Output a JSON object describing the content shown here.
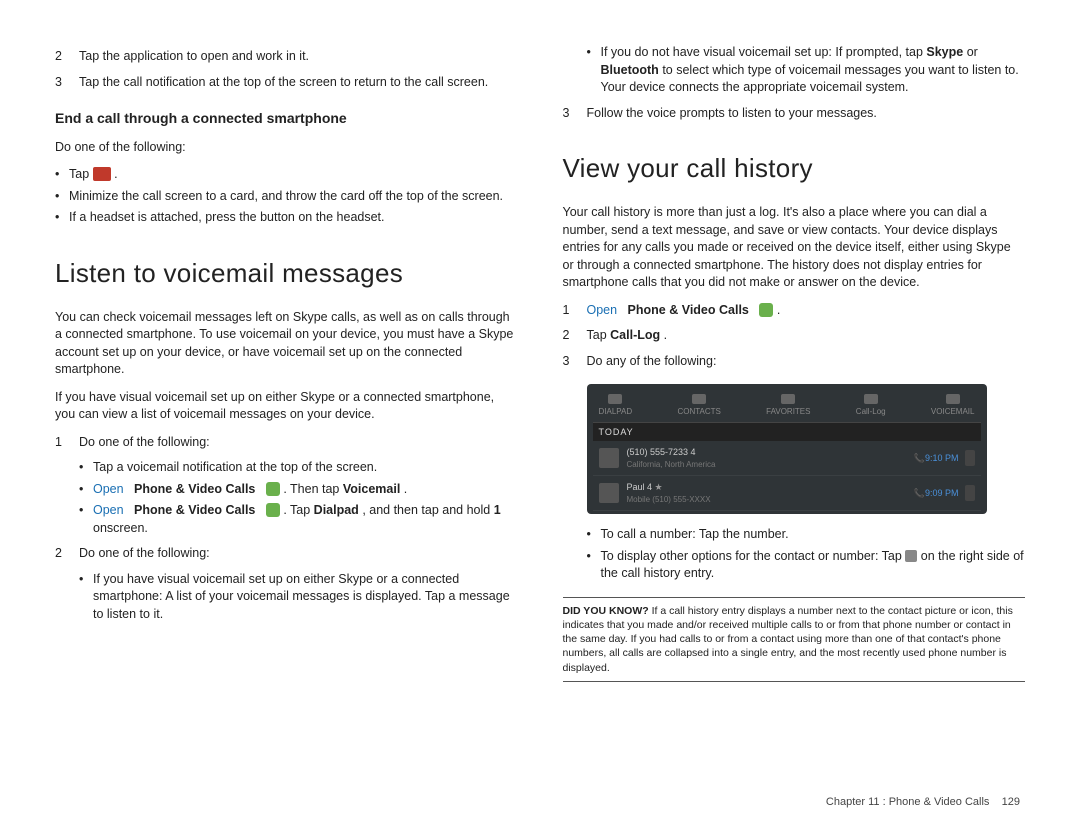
{
  "left": {
    "step2": "Tap the application to open and work in it.",
    "step3": "Tap the call notification at the top of the screen to return to the call screen.",
    "endcall_heading": "End a call through a connected smartphone",
    "do_one": "Do one of the following:",
    "b1a": "Tap ",
    "b1b": ".",
    "b2": "Minimize the call screen to a card, and throw the card off the top of the screen.",
    "b3": "If a headset is attached, press the button on the headset.",
    "voicemail_heading": "Listen to voicemail messages",
    "vm_p1": "You can check voicemail messages left on Skype calls, as well as on calls through a connected smartphone. To use voicemail on your device, you must have a Skype account set up on your device, or have voicemail set up on the connected smartphone.",
    "vm_p2": "If you have visual voicemail set up on either Skype or a connected smartphone, you can view a list of voicemail messages on your device.",
    "vm_s1": "Do one of the following:",
    "vm_s1_b1": "Tap a voicemail notification at the top of the screen.",
    "vm_s1_b2a": "Open",
    "vm_s1_b2b": "Phone & Video Calls",
    "vm_s1_b2c": ". Then tap ",
    "vm_s1_b2d": "Voicemail",
    "vm_s1_b2e": ".",
    "vm_s1_b3a": "Open",
    "vm_s1_b3b": "Phone & Video Calls",
    "vm_s1_b3c": ". Tap ",
    "vm_s1_b3d": "Dialpad",
    "vm_s1_b3e": ", and then tap and hold ",
    "vm_s1_b3f": "1",
    "vm_s1_b3g": " onscreen.",
    "vm_s2": "Do one of the following:",
    "vm_s2_b1": "If you have visual voicemail set up on either Skype or a connected smartphone: A list of your voicemail messages is displayed. Tap a message to listen to it."
  },
  "right": {
    "cont_b1a": "If you do not have visual voicemail set up: If prompted, tap ",
    "cont_b1b": "Skype",
    "cont_b1c": " or ",
    "cont_b1d": "Bluetooth",
    "cont_b1e": " to select which type of voicemail messages you want to listen to. Your device connects the appropriate voicemail system.",
    "s3": "Follow the voice prompts to listen to your messages.",
    "history_heading": "View your call history",
    "hist_p1": "Your call history is more than just a log. It's also a place where you can dial a number, send a text message, and save or view contacts. Your device displays entries for any calls you made or received on the device itself, either using Skype or through a connected smartphone. The history does not display entries for smartphone calls that you did not make or answer on the device.",
    "hist_s1a": "Open",
    "hist_s1b": "Phone & Video Calls",
    "hist_s1c": ".",
    "hist_s2a": "Tap ",
    "hist_s2b": "Call-Log",
    "hist_s2c": ".",
    "hist_s3": "Do any of the following:",
    "shot": {
      "tabs": [
        "DIALPAD",
        "CONTACTS",
        "FAVORITES",
        "Call-Log",
        "VOICEMAIL"
      ],
      "today": "TODAY",
      "r1_num": "(510) 555-7233  4",
      "r1_sub": "California, North America",
      "r1_time": "9:10 PM",
      "r2_num": "Paul  4",
      "r2_star": "★",
      "r2_sub": "Mobile (510) 555-XXXX",
      "r2_time": "9:09 PM"
    },
    "hist_b1": "To call a number: Tap the number.",
    "hist_b2a": "To display other options for the contact or number: Tap ",
    "hist_b2b": " on the right side of the call history entry.",
    "dyk_label": "DID YOU KNOW?",
    "dyk_text": " If a call history entry displays a number next to the contact picture or icon, this indicates that you made and/or received multiple calls to or from that phone number or contact in the same day. If you had calls to or from a contact using more than one of that contact's phone numbers, all calls are collapsed into a single entry, and the most recently used phone number is displayed."
  },
  "footer": {
    "chapter": "Chapter 11 : Phone & Video Calls",
    "page": "129"
  }
}
